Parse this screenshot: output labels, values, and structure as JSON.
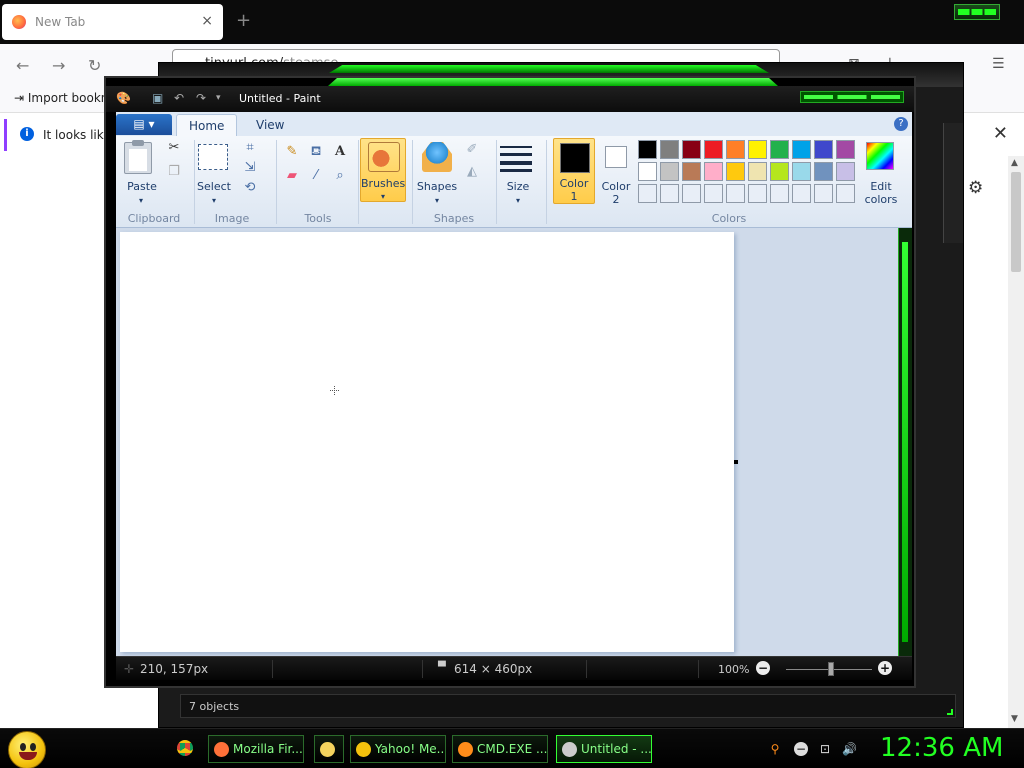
{
  "firefox": {
    "tab_title": "New Tab",
    "tab_close": "×",
    "new_tab": "+",
    "url": "tinyurl.com/",
    "url_grey": "steamse",
    "bookmarks_import": "Import bookn",
    "info_text": "It looks like",
    "info_close": "✕"
  },
  "paint": {
    "title": "Untitled - Paint",
    "tabs": {
      "home": "Home",
      "view": "View"
    },
    "help": "?",
    "groups": {
      "clipboard": "Clipboard",
      "image": "Image",
      "tools": "Tools",
      "shapes": "Shapes",
      "colors": "Colors"
    },
    "buttons": {
      "paste": "Paste",
      "select": "Select",
      "brushes": "Brushes",
      "shapes": "Shapes",
      "size": "Size",
      "color1_a": "Color",
      "color1_b": "1",
      "color2_a": "Color",
      "color2_b": "2",
      "edit_colors_a": "Edit",
      "edit_colors_b": "colors"
    },
    "palette_row1": [
      "#000000",
      "#7f7f7f",
      "#880015",
      "#ed1c24",
      "#ff7f27",
      "#fff200",
      "#22b14c",
      "#00a2e8",
      "#3f48cc",
      "#a349a4"
    ],
    "palette_row2": [
      "#ffffff",
      "#c3c3c3",
      "#b97a57",
      "#ffaec9",
      "#ffc90e",
      "#efe4b0",
      "#b5e61d",
      "#99d9ea",
      "#7092be",
      "#c8bfe7"
    ],
    "palette_row3": [
      "#e8eef7",
      "#e8eef7",
      "#e8eef7",
      "#e8eef7",
      "#e8eef7",
      "#e8eef7",
      "#e8eef7",
      "#e8eef7",
      "#e8eef7",
      "#e8eef7"
    ],
    "color1": "#000000",
    "color2": "#ffffff",
    "status": {
      "cursor_pos": "210, 157px",
      "image_size": "614 × 460px",
      "zoom": "100%",
      "zoom_out": "−",
      "zoom_in": "+"
    }
  },
  "background_window": {
    "status_text": "7 objects"
  },
  "taskbar": {
    "items": [
      {
        "label": "Mozilla Fir...",
        "icon_color": "#ff7139"
      },
      {
        "label": "",
        "icon_color": "#f4d35e"
      },
      {
        "label": "Yahoo! Me...",
        "icon_color": "#f4c20d"
      },
      {
        "label": "CMD.EXE ...",
        "icon_color": "#ff8c1a"
      },
      {
        "label": "Untitled - ...",
        "icon_color": "#cccccc"
      }
    ],
    "clock": "12:36 AM"
  }
}
